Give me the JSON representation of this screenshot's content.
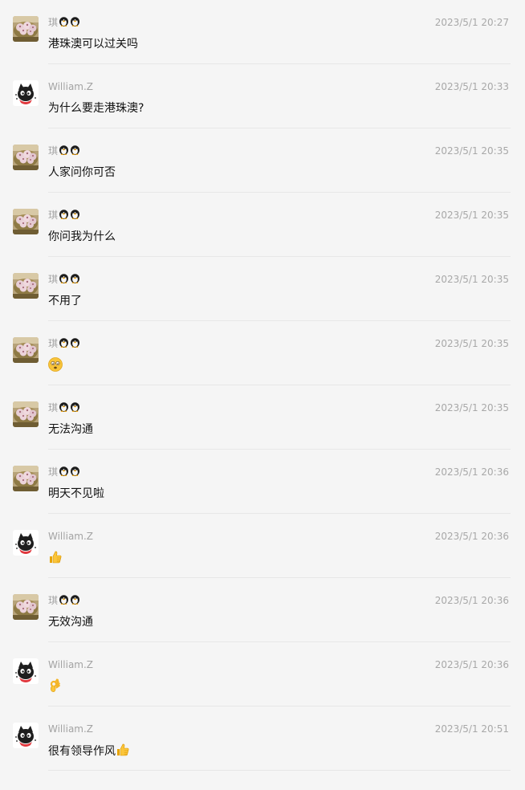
{
  "users": {
    "qi": {
      "name": "琪",
      "suffix_icons": [
        "penguin-emoji",
        "penguin-emoji"
      ],
      "avatar_icon": "steamed-buns-avatar"
    },
    "william": {
      "name": "William.Z",
      "avatar_icon": "black-cat-avatar"
    }
  },
  "messages": [
    {
      "sender": "琪",
      "time": "2023/5/1 20:27",
      "text": "港珠澳可以过关吗"
    },
    {
      "sender": "William.Z",
      "time": "2023/5/1 20:33",
      "text": "为什么要走港珠澳?"
    },
    {
      "sender": "琪",
      "time": "2023/5/1 20:35",
      "text": "人家问你可否"
    },
    {
      "sender": "琪",
      "time": "2023/5/1 20:35",
      "text": "你问我为什么"
    },
    {
      "sender": "琪",
      "time": "2023/5/1 20:35",
      "text": "不用了"
    },
    {
      "sender": "琪",
      "time": "2023/5/1 20:35",
      "text": "",
      "emoji": "dizzy-face-emoji"
    },
    {
      "sender": "琪",
      "time": "2023/5/1 20:35",
      "text": "无法沟通"
    },
    {
      "sender": "琪",
      "time": "2023/5/1 20:36",
      "text": "明天不见啦"
    },
    {
      "sender": "William.Z",
      "time": "2023/5/1 20:36",
      "text": "",
      "emoji": "thumbs-up-emoji"
    },
    {
      "sender": "琪",
      "time": "2023/5/1 20:36",
      "text": "无效沟通"
    },
    {
      "sender": "William.Z",
      "time": "2023/5/1 20:36",
      "text": "",
      "emoji": "ok-hand-emoji"
    },
    {
      "sender": "William.Z",
      "time": "2023/5/1 20:51",
      "text": "很有领导作风",
      "emoji": "thumbs-up-emoji"
    }
  ]
}
